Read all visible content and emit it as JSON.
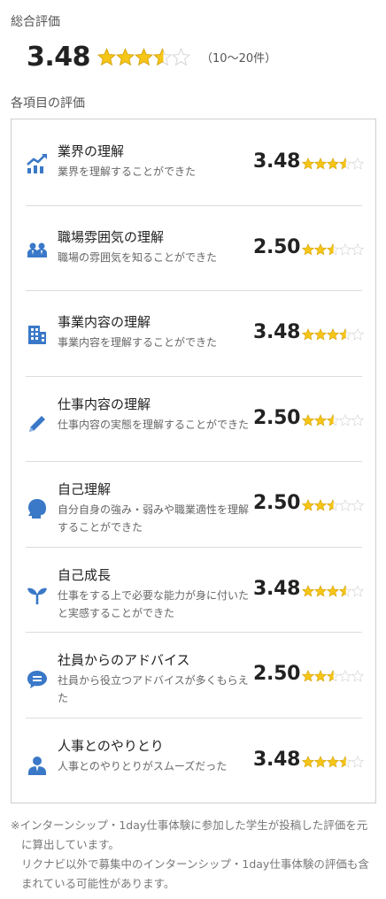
{
  "overall": {
    "label": "総合評価",
    "score": "3.48",
    "rating": 3.48,
    "count": "（10〜20件）"
  },
  "items_label": "各項目の評価",
  "items": [
    {
      "title": "業界の理解",
      "desc": "業界を理解することができた",
      "score": "3.48",
      "rating": 3.48,
      "icon": "chart-icon"
    },
    {
      "title": "職場雰囲気の理解",
      "desc": "職場の雰囲気を知ることができた",
      "score": "2.50",
      "rating": 2.5,
      "icon": "people-icon"
    },
    {
      "title": "事業内容の理解",
      "desc": "事業内容を理解することができた",
      "score": "3.48",
      "rating": 3.48,
      "icon": "building-icon"
    },
    {
      "title": "仕事内容の理解",
      "desc": "仕事内容の実態を理解することができた",
      "score": "2.50",
      "rating": 2.5,
      "icon": "pencil-icon"
    },
    {
      "title": "自己理解",
      "desc": "自分自身の強み・弱みや職業適性を理解することができた",
      "score": "2.50",
      "rating": 2.5,
      "icon": "head-icon"
    },
    {
      "title": "自己成長",
      "desc": "仕事をする上で必要な能力が身に付いたと実感することができた",
      "score": "3.48",
      "rating": 3.48,
      "icon": "sprout-icon"
    },
    {
      "title": "社員からのアドバイス",
      "desc": "社員から役立つアドバイスが多くもらえた",
      "score": "2.50",
      "rating": 2.5,
      "icon": "speech-bubble-icon"
    },
    {
      "title": "人事とのやりとり",
      "desc": "人事とのやりとりがスムーズだった",
      "score": "3.48",
      "rating": 3.48,
      "icon": "person-icon"
    }
  ],
  "note": {
    "line1": "※インターンシップ・1day仕事体験に参加した学生が投稿した評価を元に算出しています。",
    "line2": "リクナビ以外で募集中のインターンシップ・1day仕事体験の評価も含まれている可能性があります。"
  },
  "colors": {
    "accent": "#3a78c8",
    "star_fill": "#f5c518",
    "star_empty": "#d6d6d6"
  }
}
